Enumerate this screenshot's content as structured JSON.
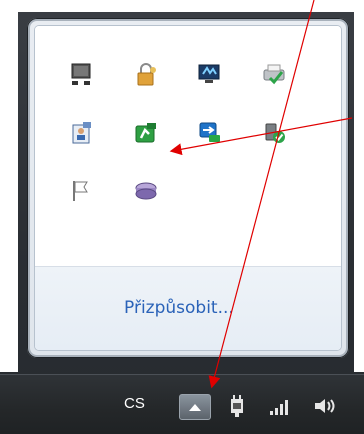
{
  "flyout": {
    "customize_label": "Přizpůsobit...",
    "icons": [
      {
        "name": "monitor-icon"
      },
      {
        "name": "lock-icon"
      },
      {
        "name": "network-display-icon"
      },
      {
        "name": "printer-check-icon"
      },
      {
        "name": "user-card-icon"
      },
      {
        "name": "green-app-icon"
      },
      {
        "name": "remote-desktop-icon"
      },
      {
        "name": "usb-check-icon"
      },
      {
        "name": "flag-icon"
      },
      {
        "name": "disk-icon"
      }
    ]
  },
  "taskbar": {
    "language": "CS",
    "show_hidden_icon": "triangle-up-icon",
    "tray_icons": [
      "power-plug-icon",
      "signal-bars-icon",
      "speaker-icon"
    ]
  },
  "colors": {
    "link": "#2a62b8",
    "annotation": "#e00000",
    "taskbar": "#242729"
  }
}
